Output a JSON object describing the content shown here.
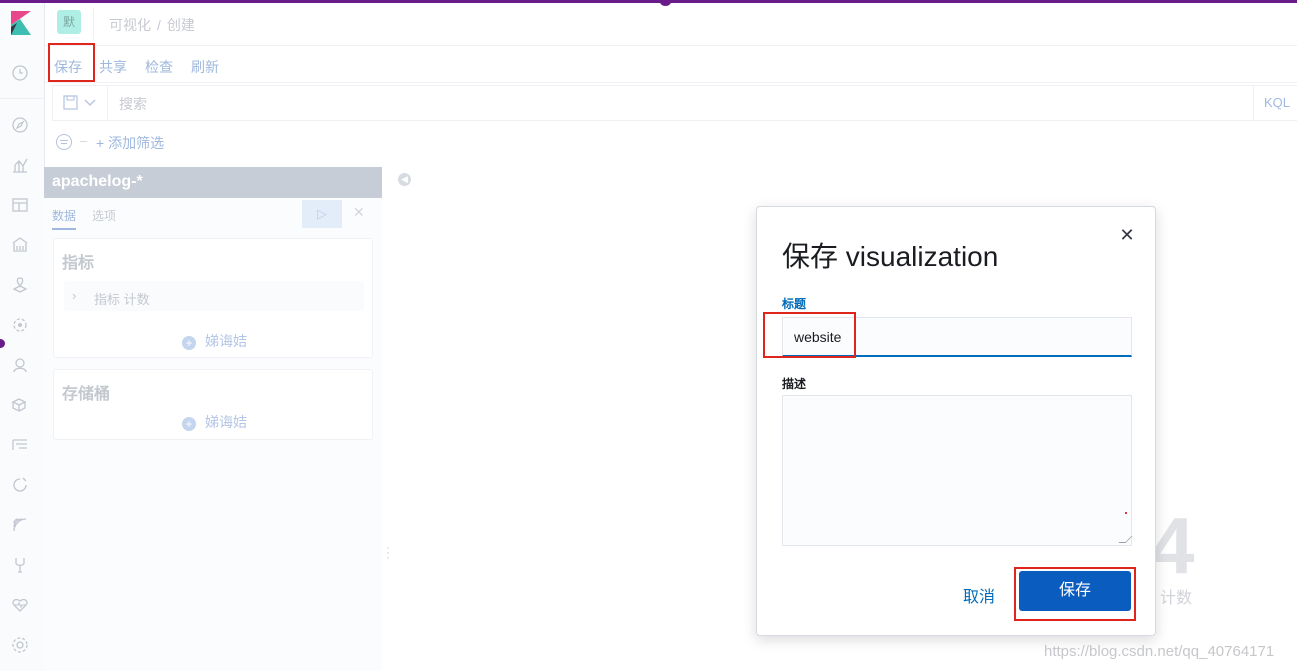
{
  "header": {
    "space_initial": "默",
    "breadcrumbs": [
      "可视化",
      "/",
      "创建"
    ]
  },
  "topmenu": {
    "save": "保存",
    "share": "共享",
    "inspect": "检查",
    "refresh": "刷新"
  },
  "search": {
    "placeholder": "搜索",
    "language": "KQL"
  },
  "filters": {
    "add_label": "+ 添加筛选"
  },
  "editor": {
    "index_pattern": "apachelog-*",
    "tabs": [
      "数据",
      "选项"
    ],
    "metrics_title": "指标",
    "metric_item": "指标 计数",
    "add_label": "娣诲姞",
    "buckets_title": "存储桶"
  },
  "background": {
    "metric_value": "4",
    "metric_label": "计数"
  },
  "modal": {
    "title": "保存 visualization",
    "title_label": "标题",
    "title_value": "website",
    "description_label": "描述",
    "description_value": "",
    "cancel": "取消",
    "confirm": "保存"
  },
  "watermark": "https://blog.csdn.net/qq_40764171",
  "icons": {
    "close": "close-icon",
    "collapse": "chevron-left-icon"
  },
  "colors": {
    "accent": "#006bb8",
    "primary_button": "#0b5cbf",
    "highlight": "#e0251c",
    "progress": "#6a1b8a"
  }
}
